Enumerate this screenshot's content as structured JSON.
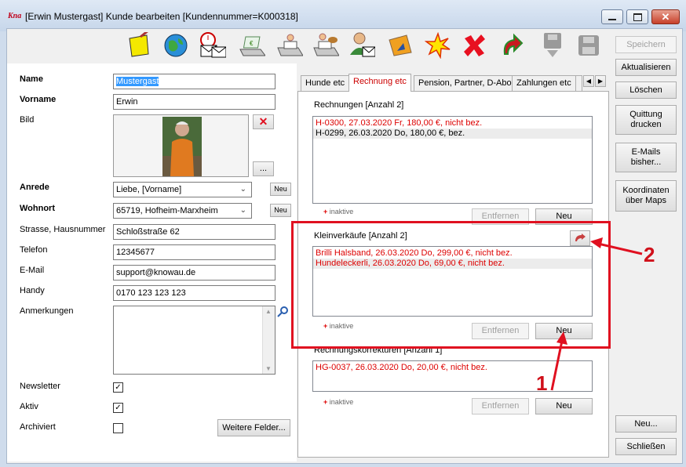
{
  "window": {
    "title": "[Erwin Mustergast] Kunde bearbeiten [Kundennummer=K000318]",
    "logo": "Kna"
  },
  "toolbar": {
    "icons": [
      "note-icon",
      "globe-icon",
      "mail-clock-icon",
      "cash-register-icon",
      "printer-user-icon",
      "printer-dog-icon",
      "user-mail-icon",
      "folder-arrow-icon",
      "burst-icon",
      "cross-icon",
      "undo-arrow-icon",
      "save-disabled-icon",
      "disk-disabled-icon"
    ]
  },
  "form": {
    "name_label": "Name",
    "name_value": "Mustergast",
    "vorname_label": "Vorname",
    "vorname_value": "Erwin",
    "bild_label": "Bild",
    "bild_more": "...",
    "anrede_label": "Anrede",
    "anrede_value": "Liebe, [Vorname]",
    "wohnort_label": "Wohnort",
    "wohnort_value": "65719, Hofheim-Marxheim",
    "neu_small": "Neu",
    "strasse_label": "Strasse, Hausnummer",
    "strasse_value": "Schloßstraße 62",
    "telefon_label": "Telefon",
    "telefon_value": "12345677",
    "email_label": "E-Mail",
    "email_value": "support@knowau.de",
    "handy_label": "Handy",
    "handy_value": "0170 123 123 123",
    "anmerkungen_label": "Anmerkungen",
    "newsletter_label": "Newsletter",
    "aktiv_label": "Aktiv",
    "archiviert_label": "Archiviert",
    "check": "✓",
    "weitere_button": "Weitere Felder..."
  },
  "tabs": [
    {
      "label": "Hunde etc"
    },
    {
      "label": "Rechnung etc"
    },
    {
      "label": "Pension, Partner, D-Abo"
    },
    {
      "label": "Zahlungen etc"
    }
  ],
  "rechnungen": {
    "header": "Rechnungen [Anzahl 2]",
    "items": [
      "H-0300, 27.03.2020 Fr, 180,00 €, nicht bez.",
      "H-0299, 26.03.2020 Do, 180,00 €, bez."
    ],
    "inaktive": "inaktive",
    "entfernen": "Entfernen",
    "neu": "Neu"
  },
  "kleinverkaeufe": {
    "header": "Kleinverkäufe [Anzahl 2]",
    "items": [
      "Brilli Halsband, 26.03.2020 Do, 299,00 €, nicht bez.",
      "Hundeleckerli, 26.03.2020 Do, 69,00 €, nicht bez."
    ],
    "inaktive": "inaktive",
    "entfernen": "Entfernen",
    "neu": "Neu"
  },
  "korrekturen": {
    "header": "Rechnungskorrekturen [Anzahl 1]",
    "items": [
      "HG-0037, 26.03.2020 Do, 20,00 €, nicht bez."
    ],
    "inaktive": "inaktive",
    "entfernen": "Entfernen",
    "neu": "Neu"
  },
  "sidebar": {
    "speichern": "Speichern",
    "aktualisieren": "Aktualisieren",
    "loeschen": "Löschen",
    "quittung": "Quittung drucken",
    "emails": "E-Mails bisher...",
    "koordinaten": "Koordinaten über Maps",
    "neu": "Neu...",
    "schliessen": "Schließen"
  },
  "annotations": {
    "one": "1",
    "two": "2"
  },
  "colors": {
    "accent_red": "#e01020",
    "open_item_red": "#dd0000"
  }
}
